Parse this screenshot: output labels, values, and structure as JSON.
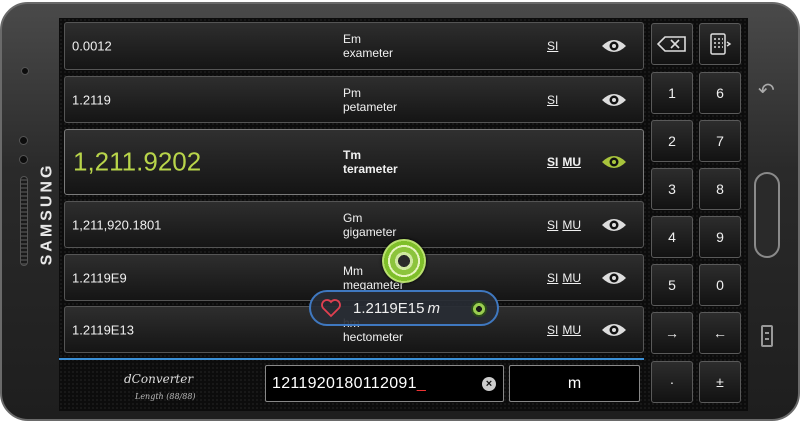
{
  "device": {
    "brand": "SAMSUNG"
  },
  "rows": [
    {
      "value": "0.0012",
      "symbol": "Em",
      "name": "exameter",
      "standards": [
        "SI"
      ]
    },
    {
      "value": "1.2119",
      "symbol": "Pm",
      "name": "petameter",
      "standards": [
        "SI"
      ]
    },
    {
      "value": "1,211.9202",
      "symbol": "Tm",
      "name": "terameter",
      "standards": [
        "SI",
        "MU"
      ],
      "selected": true
    },
    {
      "value": "1,211,920.1801",
      "symbol": "Gm",
      "name": "gigameter",
      "standards": [
        "SI",
        "MU"
      ]
    },
    {
      "value": "1.2119E9",
      "symbol": "Mm",
      "name": "megameter",
      "standards": [
        "SI",
        "MU"
      ]
    },
    {
      "value": "1.2119E13",
      "symbol": "hm",
      "name": "hectometer",
      "standards": [
        "SI",
        "MU"
      ]
    }
  ],
  "keypad": {
    "backspace": "⌫",
    "keyboard": "keyboard",
    "digits": [
      "1",
      "6",
      "2",
      "7",
      "3",
      "8",
      "4",
      "9",
      "5",
      "0"
    ],
    "arrow_right": "→",
    "arrow_left": "←",
    "dot": "·",
    "plus_minus": "±"
  },
  "bottom": {
    "app_name": "dConverter",
    "category": "Length (88/88)",
    "input_value": "1211920180112091",
    "cursor": "_",
    "unit": "m"
  },
  "overlay": {
    "value": "1.2119E15",
    "unit": "m"
  },
  "colors": {
    "accent_green": "#b8d44a",
    "accent_blue": "#3a8fd6"
  }
}
